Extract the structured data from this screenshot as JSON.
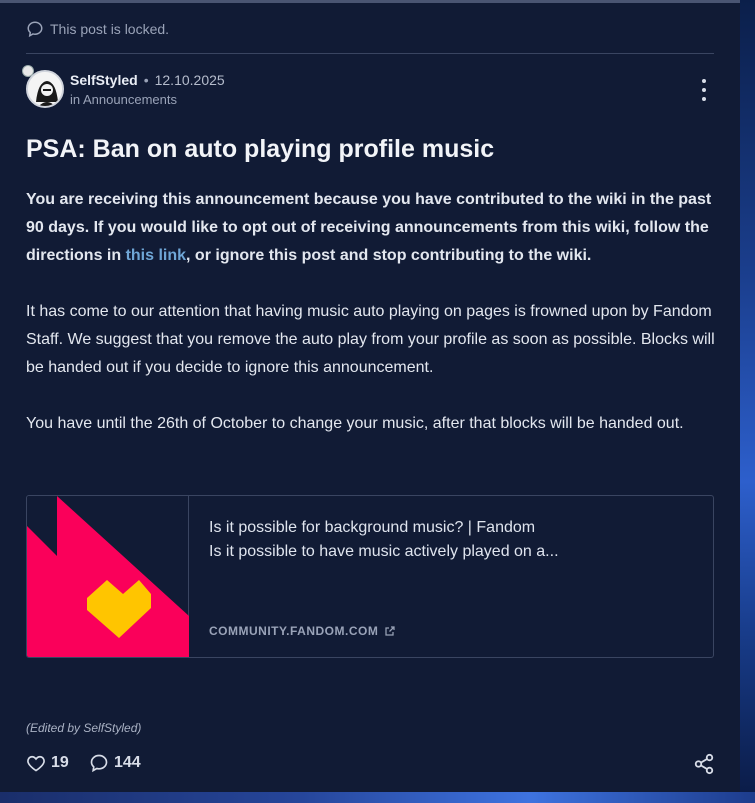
{
  "locked_notice": "This post is locked.",
  "post": {
    "author": "SelfStyled",
    "separator": "•",
    "date": "12.10.2025",
    "category": "in Announcements",
    "title": "PSA: Ban on auto playing profile music",
    "para1_before_link": "You are receiving this announcement because you have contributed to the wiki in the past 90 days. If you would like to opt out of receiving announcements from this wiki, follow the directions in ",
    "para1_link": "this link",
    "para1_after_link": ", or ignore this post and stop contributing to the wiki.",
    "para2": "It has come to our attention that having music auto playing on pages is frowned upon by Fandom Staff. We suggest that you remove the auto play from your profile as soon as possible. Blocks will be handed out if you decide to ignore this announcement.",
    "para3": "You have until the 26th of October to change your music, after that blocks will be handed out.",
    "edited_note": "(Edited by SelfStyled)"
  },
  "link_preview": {
    "title": "Is it possible for background music? | Fandom",
    "description": "Is it possible to have music actively played on a...",
    "domain": "COMMUNITY.FANDOM.COM",
    "brand_colors": {
      "flame": "#fa005a",
      "heart": "#ffc500"
    }
  },
  "actions": {
    "likes": "19",
    "replies": "144"
  },
  "icons": {
    "locked": "speech-bubble-icon",
    "more": "more-vertical-icon",
    "like": "heart-icon",
    "reply": "comment-icon",
    "share": "share-icon",
    "external": "external-link-icon"
  },
  "colors": {
    "background": "#111b35",
    "link": "#6fa6d6"
  }
}
